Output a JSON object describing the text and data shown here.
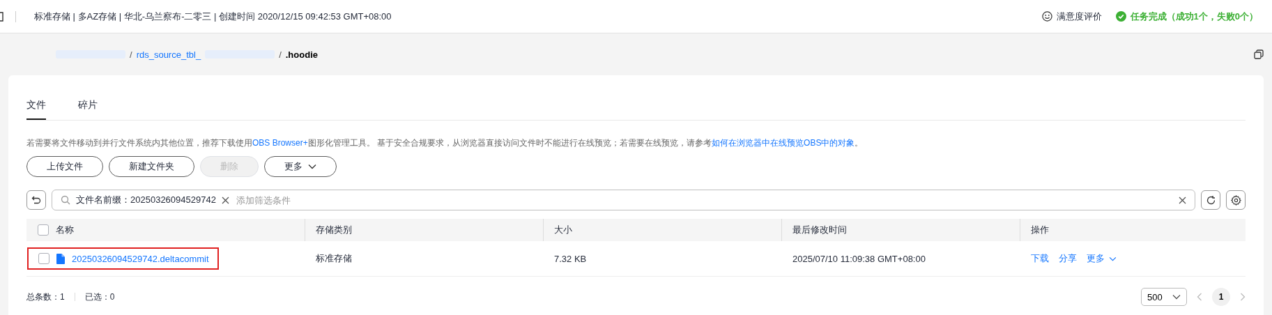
{
  "header": {
    "info": "标准存储 | 多AZ存储 | 华北-乌兰察布-二零三 | 创建时间  2020/12/15 09:42:53 GMT+08:00",
    "feedback": "满意度评价",
    "task_status": "任务完成（成功1个，失败0个）"
  },
  "breadcrumb": [
    {
      "kind": "redacted"
    },
    {
      "kind": "separator",
      "text": "/"
    },
    {
      "kind": "link",
      "text": "rds_source_tbl_"
    },
    {
      "kind": "redacted"
    },
    {
      "kind": "separator",
      "text": "/"
    },
    {
      "kind": "current",
      "text": ".hoodie"
    }
  ],
  "tabs": [
    {
      "label": "文件",
      "selected": true
    },
    {
      "label": "碎片",
      "selected": false
    }
  ],
  "notice": [
    {
      "kind": "text",
      "text": "若需要将文件移动到并行文件系统内其他位置，推荐下载使用"
    },
    {
      "kind": "link",
      "text": "OBS Browser+"
    },
    {
      "kind": "text",
      "text": "图形化管理工具。 基于安全合规要求，从浏览器直接访问文件时不能进行在线预览；若需要在线预览，请参考"
    },
    {
      "kind": "link",
      "text": "如何在浏览器中在线预览OBS中的对象"
    },
    {
      "kind": "text",
      "text": "。"
    }
  ],
  "buttons": [
    {
      "label": "上传文件",
      "kind": "button",
      "disabled": false
    },
    {
      "label": "新建文件夹",
      "kind": "button",
      "disabled": false
    },
    {
      "label": "删除",
      "kind": "button",
      "disabled": true
    },
    {
      "label": "更多",
      "kind": "dropdown",
      "disabled": false
    }
  ],
  "filter": {
    "tag": "文件名前缀：20250326094529742",
    "placeholder": "添加筛选条件"
  },
  "table": {
    "header_checked": false,
    "columns": [
      "名称",
      "存储类别",
      "大小",
      "最后修改时间",
      "操作"
    ],
    "rows": [
      {
        "checked": false,
        "highlighted": true,
        "name": "20250326094529742.deltacommit",
        "storage_class": "标准存储",
        "size": "7.32 KB",
        "modified": "2025/07/10 11:09:38 GMT+08:00",
        "actions": [
          {
            "label": "下载",
            "kind": "link"
          },
          {
            "label": "分享",
            "kind": "link"
          },
          {
            "label": "更多",
            "kind": "dropdown"
          }
        ]
      }
    ]
  },
  "footer": {
    "total": "总条数：1",
    "selected": "已选：0"
  },
  "pagination": {
    "page_size": "500",
    "pages": [
      {
        "label": "1",
        "selected": true
      }
    ]
  }
}
